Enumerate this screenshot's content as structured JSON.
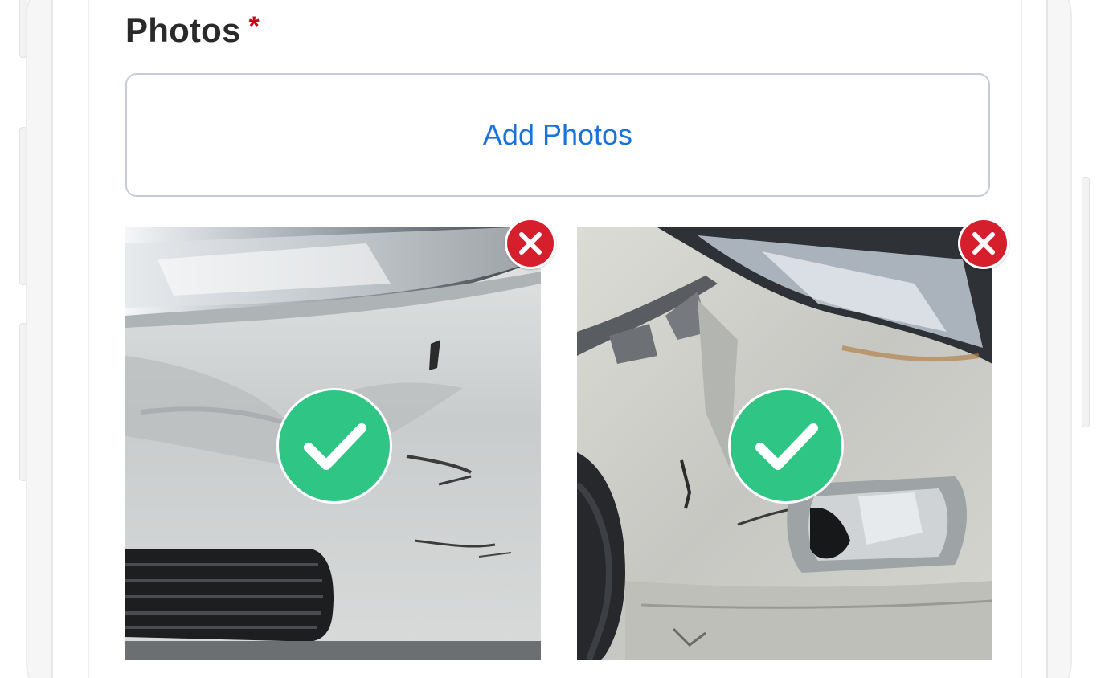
{
  "photos_section": {
    "title": "Photos",
    "required_mark": "*",
    "add_button_label": "Add Photos"
  },
  "photos": [
    {
      "status_icon": "check-icon",
      "remove_icon": "close-icon"
    },
    {
      "status_icon": "check-icon",
      "remove_icon": "close-icon"
    }
  ],
  "colors": {
    "accent_blue": "#1a73d9",
    "required_red": "#d0021b",
    "check_green": "#2ec585",
    "remove_red": "#d61f2c"
  }
}
